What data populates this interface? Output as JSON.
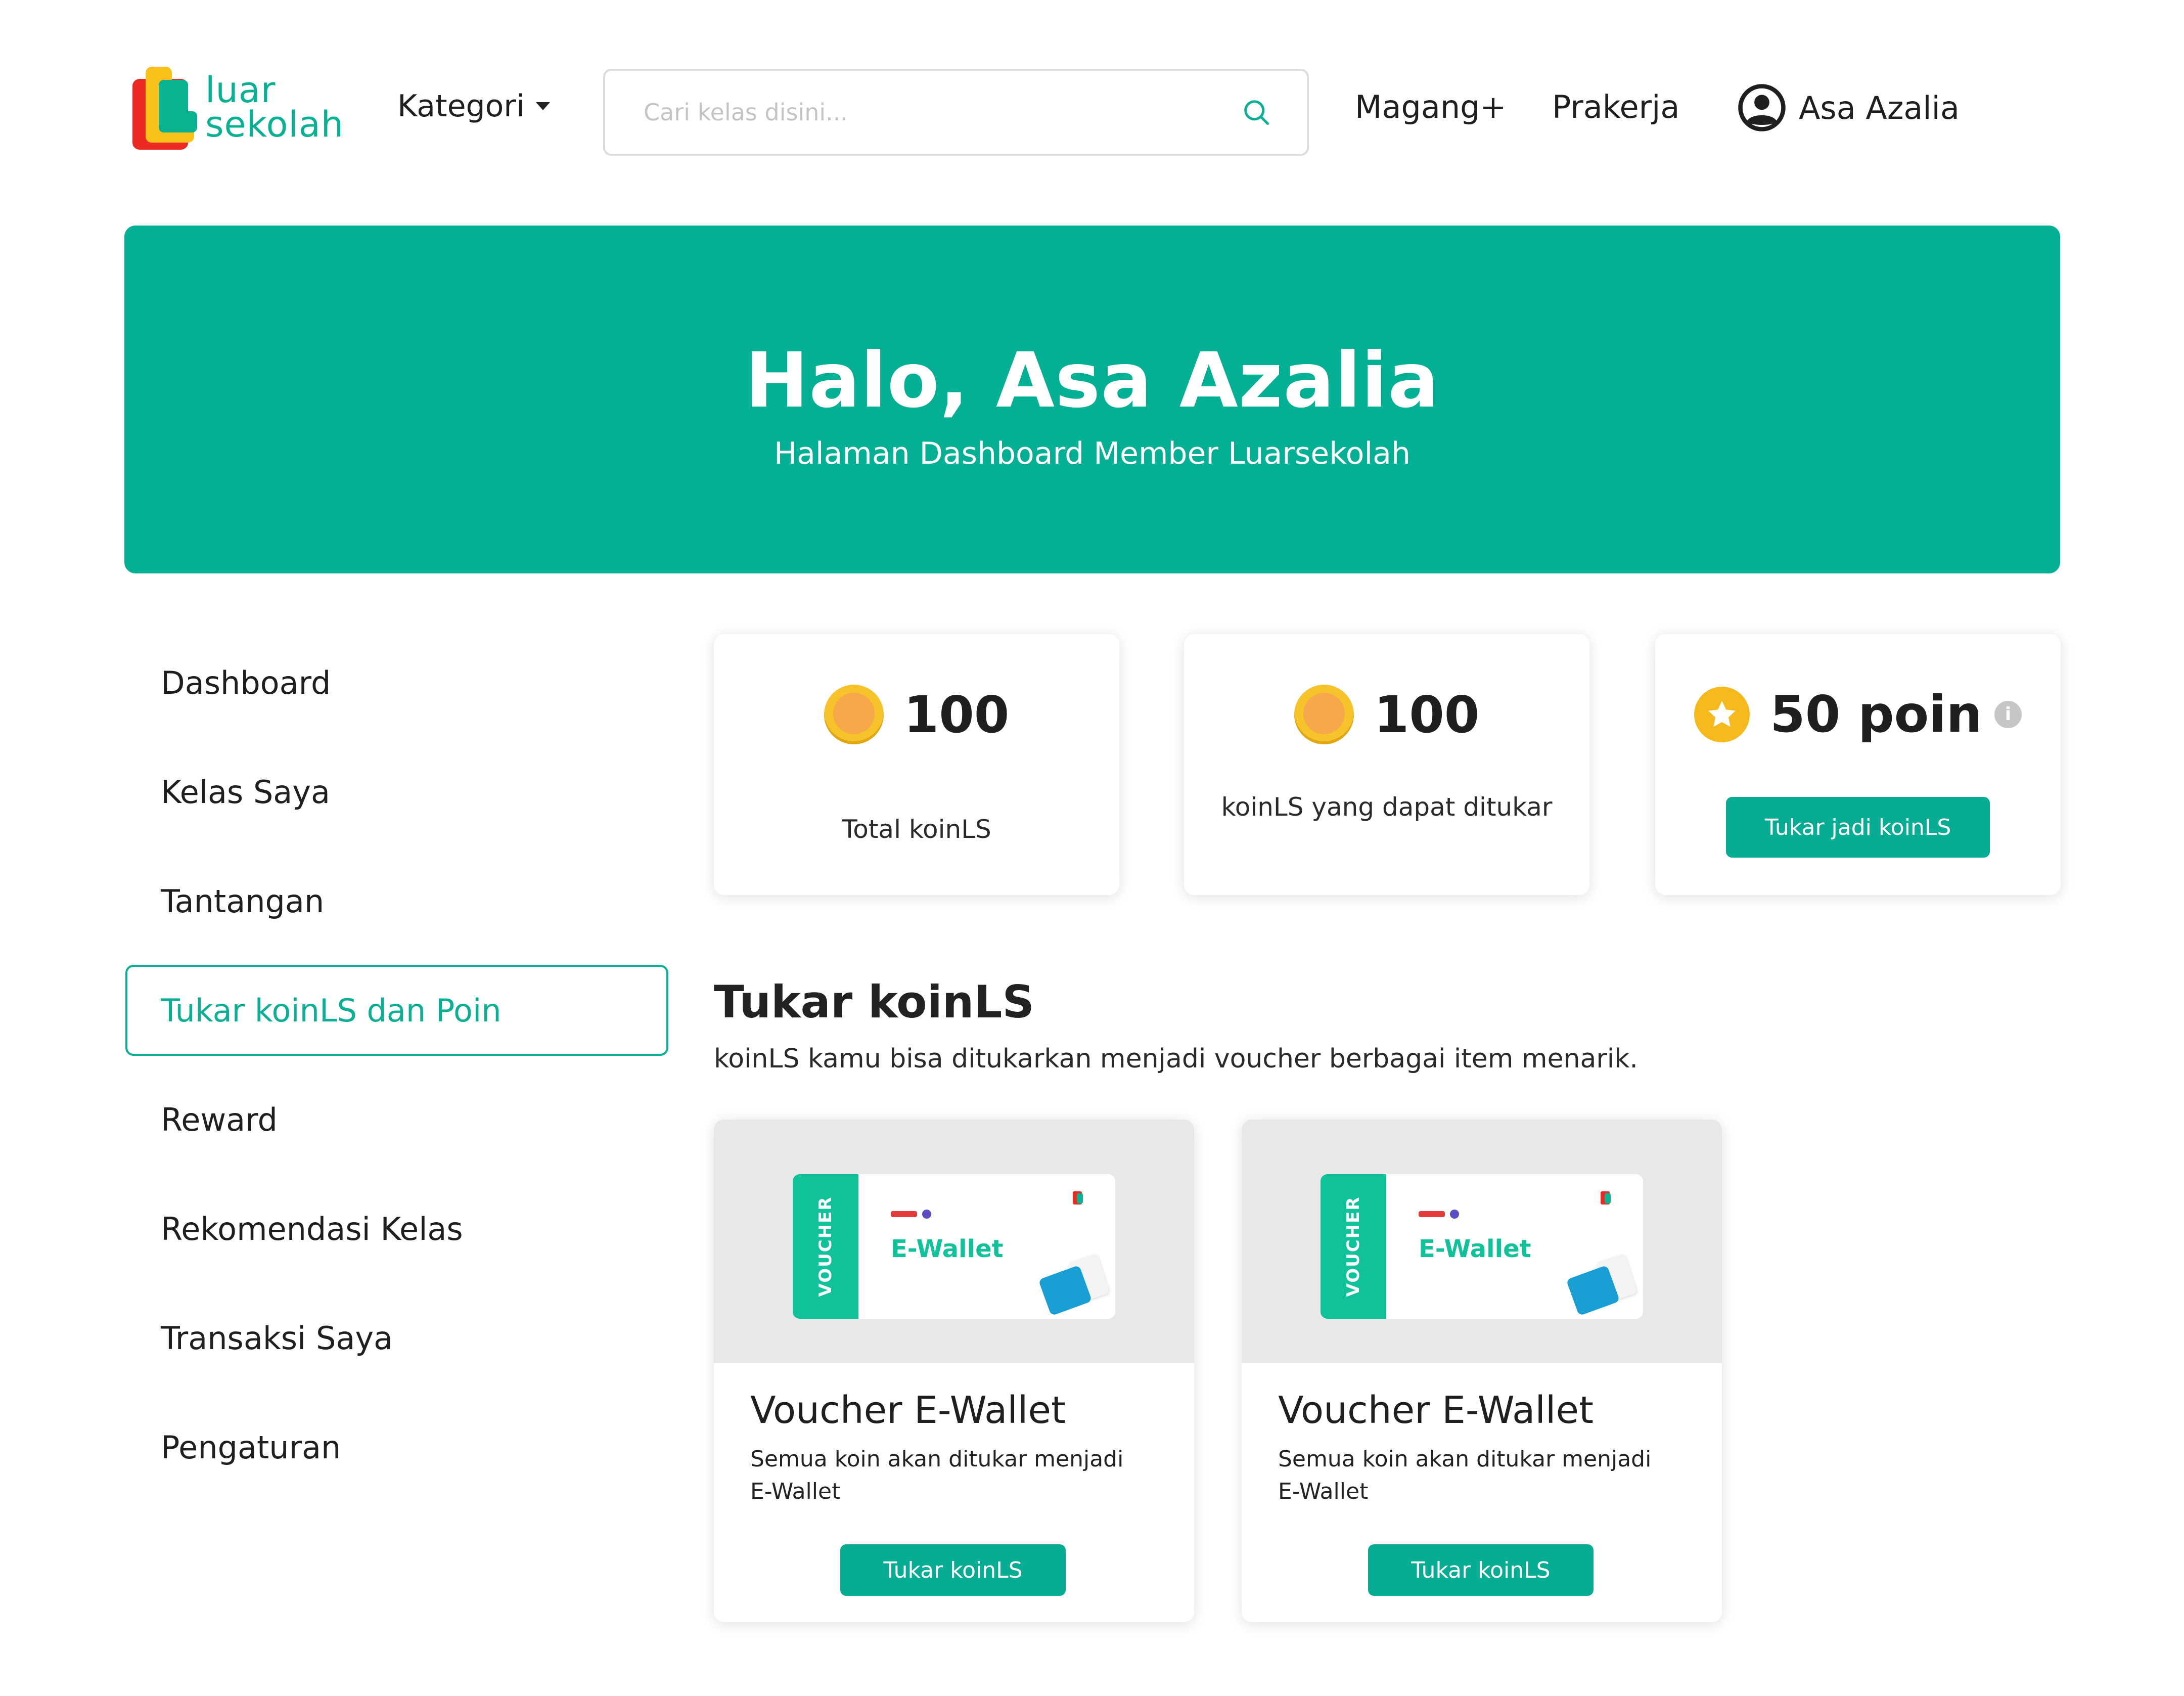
{
  "header": {
    "logo_line1": "luar",
    "logo_line2": "sekolah",
    "kategori_label": "Kategori",
    "search_placeholder": "Cari kelas disini...",
    "magang_label": "Magang+",
    "prakerja_label": "Prakerja",
    "user_name": "Asa Azalia"
  },
  "hero": {
    "title": "Halo, Asa Azalia",
    "subtitle": "Halaman Dashboard Member Luarsekolah"
  },
  "sidebar": {
    "items": [
      {
        "label": "Dashboard",
        "active": false
      },
      {
        "label": "Kelas Saya",
        "active": false
      },
      {
        "label": "Tantangan",
        "active": false
      },
      {
        "label": "Tukar koinLS dan Poin",
        "active": true
      },
      {
        "label": "Reward",
        "active": false
      },
      {
        "label": "Rekomendasi Kelas",
        "active": false
      },
      {
        "label": "Transaksi Saya",
        "active": false
      },
      {
        "label": "Pengaturan",
        "active": false
      }
    ]
  },
  "stats": {
    "total": {
      "value": "100",
      "label": "Total koinLS"
    },
    "redeemable": {
      "value": "100",
      "label": "koinLS yang dapat ditukar"
    },
    "poin": {
      "value": "50 poin",
      "button": "Tukar jadi koinLS"
    }
  },
  "section": {
    "title": "Tukar koinLS",
    "description": "koinLS kamu bisa ditukarkan menjadi voucher berbagai item menarik."
  },
  "vouchers": [
    {
      "ticket_tag": "VOUCHER",
      "ticket_text": "E-Wallet",
      "title": "Voucher E-Wallet",
      "description": "Semua koin akan ditukar menjadi E-Wallet",
      "button": "Tukar koinLS"
    },
    {
      "ticket_tag": "VOUCHER",
      "ticket_text": "E-Wallet",
      "title": "Voucher E-Wallet",
      "description": "Semua koin akan ditukar menjadi E-Wallet",
      "button": "Tukar koinLS"
    }
  ],
  "colors": {
    "brand": "#03b094",
    "button": "#06ad93",
    "coin": "#f6c32a",
    "star": "#f6b91b"
  },
  "icons": [
    "search-icon",
    "user-avatar-icon",
    "coin-icon",
    "star-icon",
    "info-icon",
    "chevron-down-icon"
  ]
}
